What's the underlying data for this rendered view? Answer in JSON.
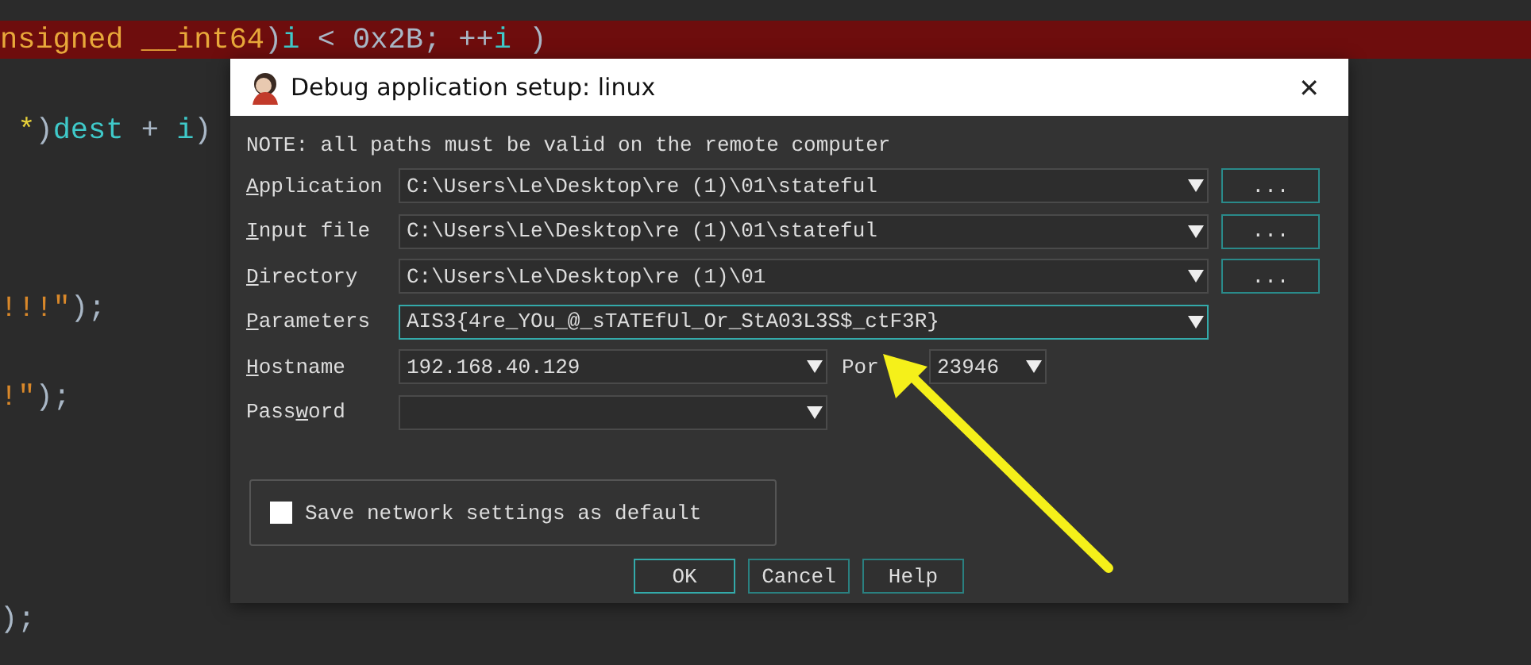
{
  "code_lines": [
    {
      "highlighted": true,
      "segments": [
        {
          "text": "nsigned __int64",
          "kind": "type"
        },
        {
          "text": ")",
          "kind": "punct"
        },
        {
          "text": "i",
          "kind": "ident"
        },
        {
          "text": " < 0x2B; ++",
          "kind": "punct"
        },
        {
          "text": "i",
          "kind": "ident"
        },
        {
          "text": " )",
          "kind": "punct"
        }
      ]
    },
    {
      "highlighted": false,
      "segments": [
        {
          "text": " *",
          "kind": "op"
        },
        {
          "text": ")",
          "kind": "punct"
        },
        {
          "text": "dest",
          "kind": "ident"
        },
        {
          "text": " + ",
          "kind": "punct"
        },
        {
          "text": "i",
          "kind": "ident"
        },
        {
          "text": ")",
          "kind": "punct"
        }
      ]
    },
    {
      "highlighted": false,
      "segments": [
        {
          "text": "!!!\"",
          "kind": "string"
        },
        {
          "text": ");",
          "kind": "punct"
        }
      ]
    },
    {
      "highlighted": false,
      "segments": [
        {
          "text": "!\"",
          "kind": "string"
        },
        {
          "text": ");",
          "kind": "punct"
        }
      ]
    },
    {
      "highlighted": false,
      "segments": [
        {
          "text": ");",
          "kind": "punct"
        }
      ]
    }
  ],
  "dialog": {
    "title": "Debug application setup: linux",
    "close": "✕",
    "note": "NOTE: all paths must be valid on the remote computer",
    "rows": [
      {
        "kind": "path",
        "label": {
          "key": "A",
          "after": "pplication"
        },
        "value": "C:\\Users\\Le\\Desktop\\re (1)\\01\\stateful",
        "focused": false,
        "browse": "..."
      },
      {
        "kind": "path",
        "label": {
          "key": "I",
          "after": "nput file"
        },
        "value": "C:\\Users\\Le\\Desktop\\re (1)\\01\\stateful",
        "focused": false,
        "browse": "..."
      },
      {
        "kind": "path",
        "label": {
          "key": "D",
          "after": "irectory"
        },
        "value": "C:\\Users\\Le\\Desktop\\re (1)\\01",
        "focused": false,
        "browse": "..."
      },
      {
        "kind": "wide",
        "label": {
          "key": "P",
          "after": "arameters"
        },
        "value": "AIS3{4re_YOu_@_sTATEfUl_Or_StA03L3S$_ctF3R}",
        "focused": true
      },
      {
        "kind": "host",
        "label": {
          "key": "H",
          "after": "ostname"
        },
        "value": "192.168.40.129",
        "focused": false,
        "port_label": "Por",
        "port": "23946"
      },
      {
        "kind": "host",
        "label": {
          "before": "Pass",
          "key": "w",
          "after": "ord"
        },
        "focused": false
      }
    ],
    "checkbox": {
      "label": "Save network settings as default",
      "checked": false
    },
    "buttons": [
      {
        "label": "OK",
        "default": true
      },
      {
        "label": "Cancel",
        "default": false
      },
      {
        "label": "Help",
        "default": false
      }
    ]
  }
}
